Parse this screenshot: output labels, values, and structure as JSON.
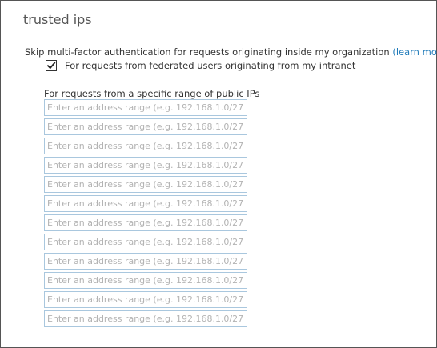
{
  "section": {
    "title": "trusted ips"
  },
  "intro": {
    "text": "Skip multi-factor authentication for requests originating inside my organization",
    "link_label": "(learn more)"
  },
  "federated_option": {
    "checked": true,
    "label": "For requests from federated users originating from my intranet"
  },
  "ip_ranges": {
    "label": "For requests from a specific range of public IPs",
    "placeholder": "Enter an address range (e.g. 192.168.1.0/27)",
    "values": [
      "",
      "",
      "",
      "",
      "",
      "",
      "",
      "",
      "",
      "",
      "",
      ""
    ]
  },
  "colors": {
    "link": "#1e7ab9",
    "input_border": "#a9c7de",
    "placeholder": "#b3b3b3"
  }
}
